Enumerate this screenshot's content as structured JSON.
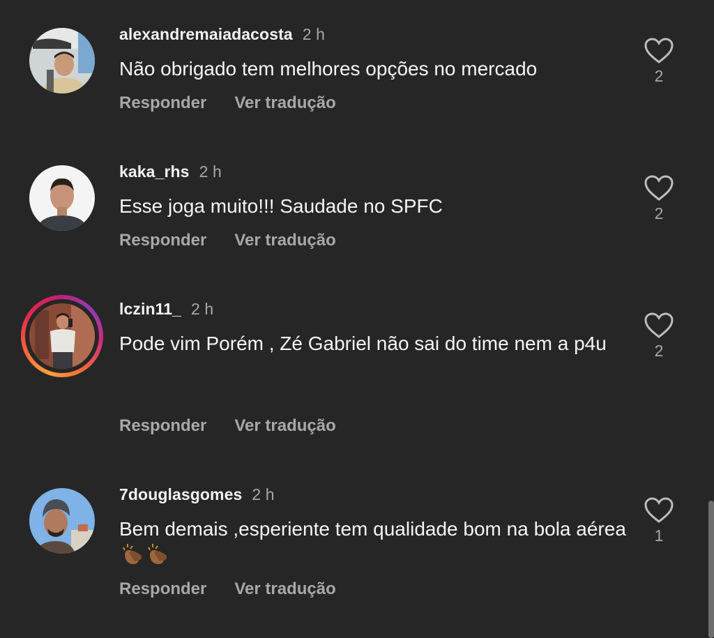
{
  "comments": [
    {
      "username": "alexandremaiadacosta",
      "time": "2 h",
      "text": "Não obrigado tem melhores opções no mercado",
      "reply_label": "Responder",
      "translate_label": "Ver tradução",
      "likes": "2"
    },
    {
      "username": "kaka_rhs",
      "time": "2 h",
      "text": "Esse joga muito!!! Saudade no SPFC",
      "reply_label": "Responder",
      "translate_label": "Ver tradução",
      "likes": "2"
    },
    {
      "username": "lczin11_",
      "time": "2 h",
      "text": "Pode vim Porém , Zé Gabriel não sai do time nem a p4u",
      "reply_label": "Responder",
      "translate_label": "Ver tradução",
      "likes": "2"
    },
    {
      "username": "7douglasgomes",
      "time": "2 h",
      "text": "Bem demais ,esperiente tem qualidade bom na bola aérea",
      "reply_label": "Responder",
      "translate_label": "Ver tradução",
      "likes": "1"
    }
  ],
  "icons": {
    "like": "heart-outline-icon",
    "emoji": "clapping-hands-emoji"
  },
  "colors": {
    "background": "#262626",
    "text_primary": "#f5f5f5",
    "text_secondary": "#a8a8a8",
    "story_ring_start": "#f9a13a",
    "story_ring_end": "#c4206c"
  }
}
